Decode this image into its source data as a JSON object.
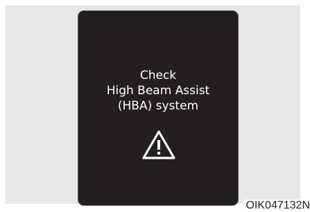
{
  "display": {
    "line1": "Check",
    "line2": "High Beam Assist",
    "line3": "(HBA) system",
    "icon": "warning-triangle-icon"
  },
  "caption": "OIK047132N",
  "colors": {
    "display_background": "#231f20",
    "text": "#ffffff",
    "frame_background": "#e7e7e8"
  }
}
